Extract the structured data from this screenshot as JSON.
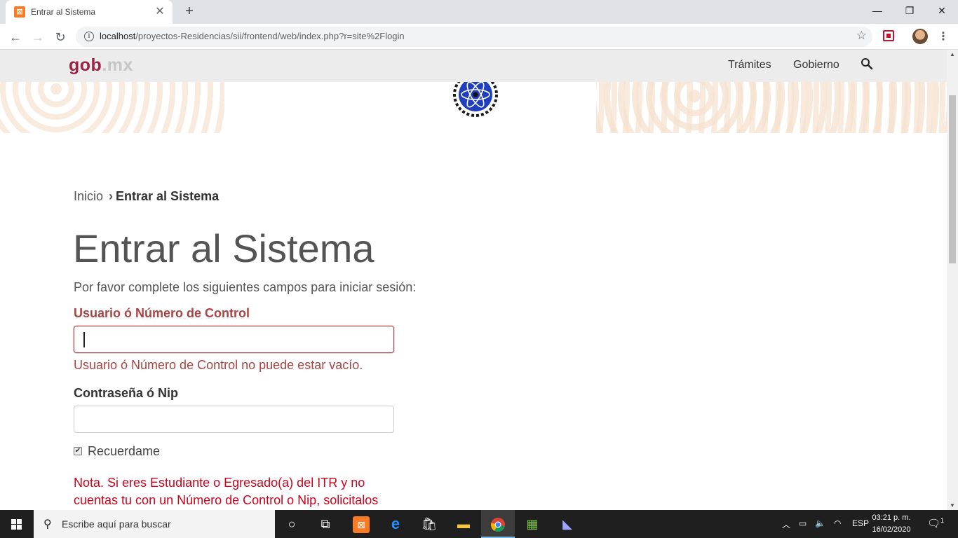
{
  "browser": {
    "tab_title": "Entrar al Sistema",
    "url_host": "localhost",
    "url_path": "/proyectos-Residencias/sii/frontend/web/index.php?r=site%2Flogin"
  },
  "header": {
    "logo_gob": "gob",
    "logo_mx": ".mx",
    "nav": [
      "Trámites",
      "Gobierno"
    ]
  },
  "breadcrumb": {
    "home": "Inicio",
    "current": "Entrar al Sistema"
  },
  "page": {
    "title": "Entrar al Sistema",
    "intro": "Por favor complete los siguientes campos para iniciar sesión:"
  },
  "form": {
    "user_label": "Usuario ó Número de Control",
    "user_value": "",
    "user_error": "Usuario ó Número de Control no puede estar vacío.",
    "pass_label": "Contraseña ó Nip",
    "pass_value": "",
    "remember_label": "Recuerdame",
    "remember_checked": true
  },
  "note": "Nota. Si eres Estudiante o Egresado(a) del ITR y no cuentas tu con un Número de Control o Nip, solicitalos",
  "taskbar": {
    "search_placeholder": "Escribe aquí para buscar",
    "language": "ESP",
    "time": "03:21 p. m.",
    "date": "16/02/2020",
    "notification_count": "1"
  }
}
